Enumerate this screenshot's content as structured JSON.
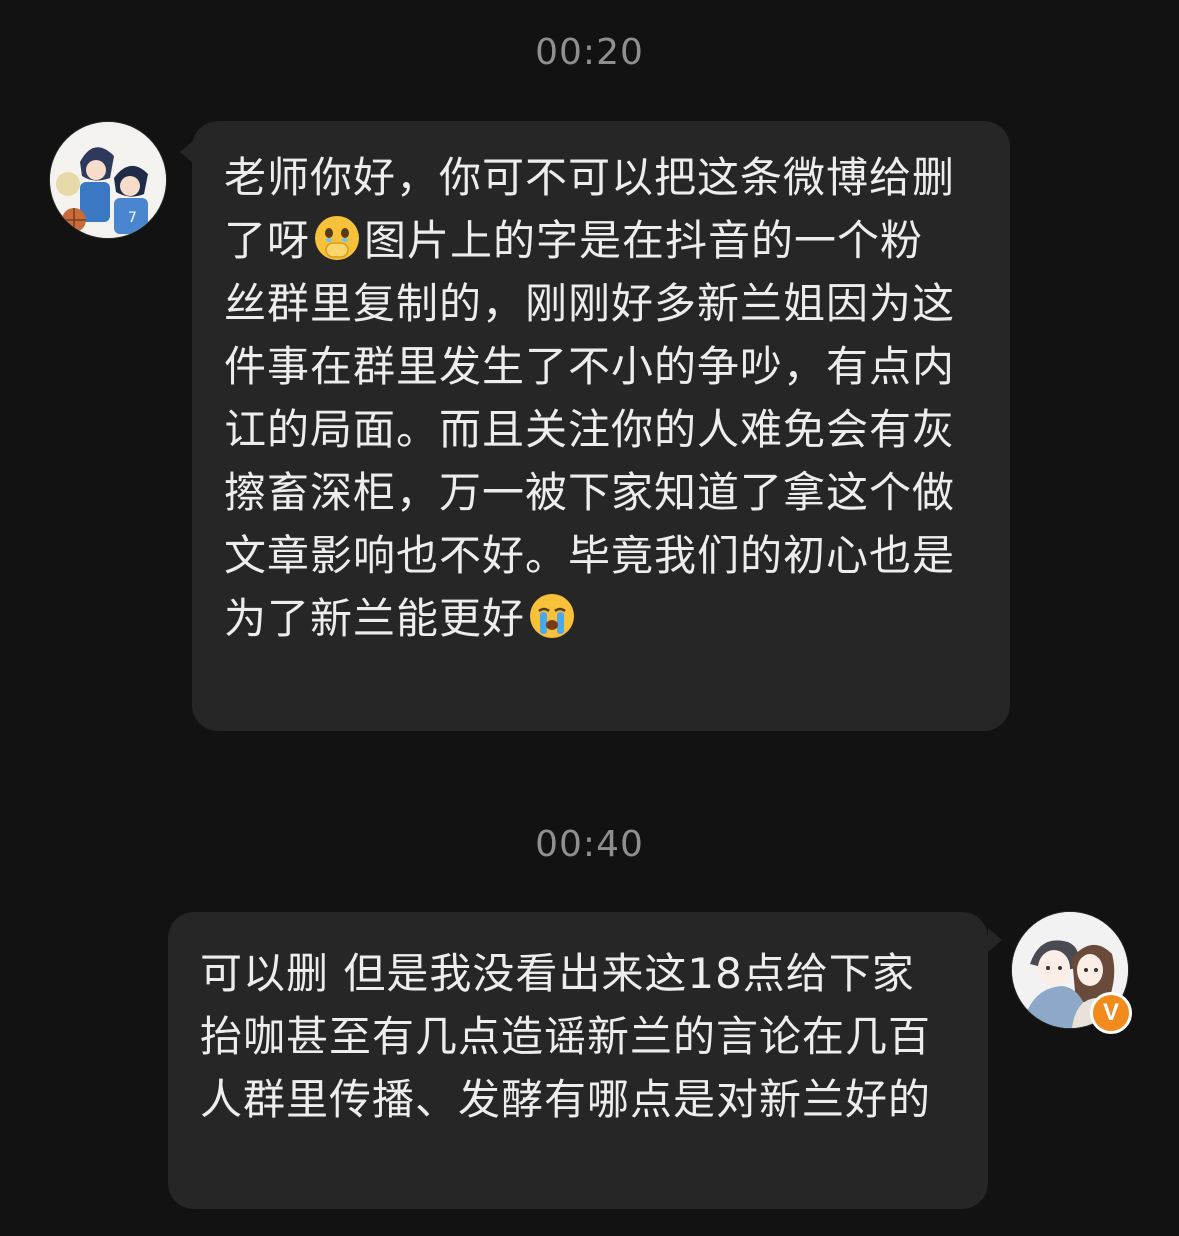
{
  "messages": [
    {
      "timestamp": "00:20",
      "side": "left",
      "avatar": "anime-couple-avatar",
      "segments": [
        "老师你好，你可不可以把这条微博给删了呀",
        "🫢",
        "图片上的字是在抖音的一个粉丝群里复制的，刚刚好多新兰姐因为这件事在群里发生了不小的争吵，有点内讧的局面。而且关注你的人难免会有灰擦畜深柜，万一被下家知道了拿这个做文章影响也不好。毕竟我们的初心也是为了新兰能更好",
        "😭"
      ]
    },
    {
      "timestamp": "00:40",
      "side": "right",
      "avatar": "sketch-couple-avatar",
      "verified_badge": "V",
      "text": "可以删 但是我没看出来这18点给下家抬咖甚至有几点造谣新兰的言论在几百人群里传播、发酵有哪点是对新兰好的"
    }
  ],
  "colors": {
    "background": "#121212",
    "bubble": "#262626",
    "text": "#ededed",
    "timestamp": "#8f8f8f",
    "badge": "#f08b1c"
  }
}
